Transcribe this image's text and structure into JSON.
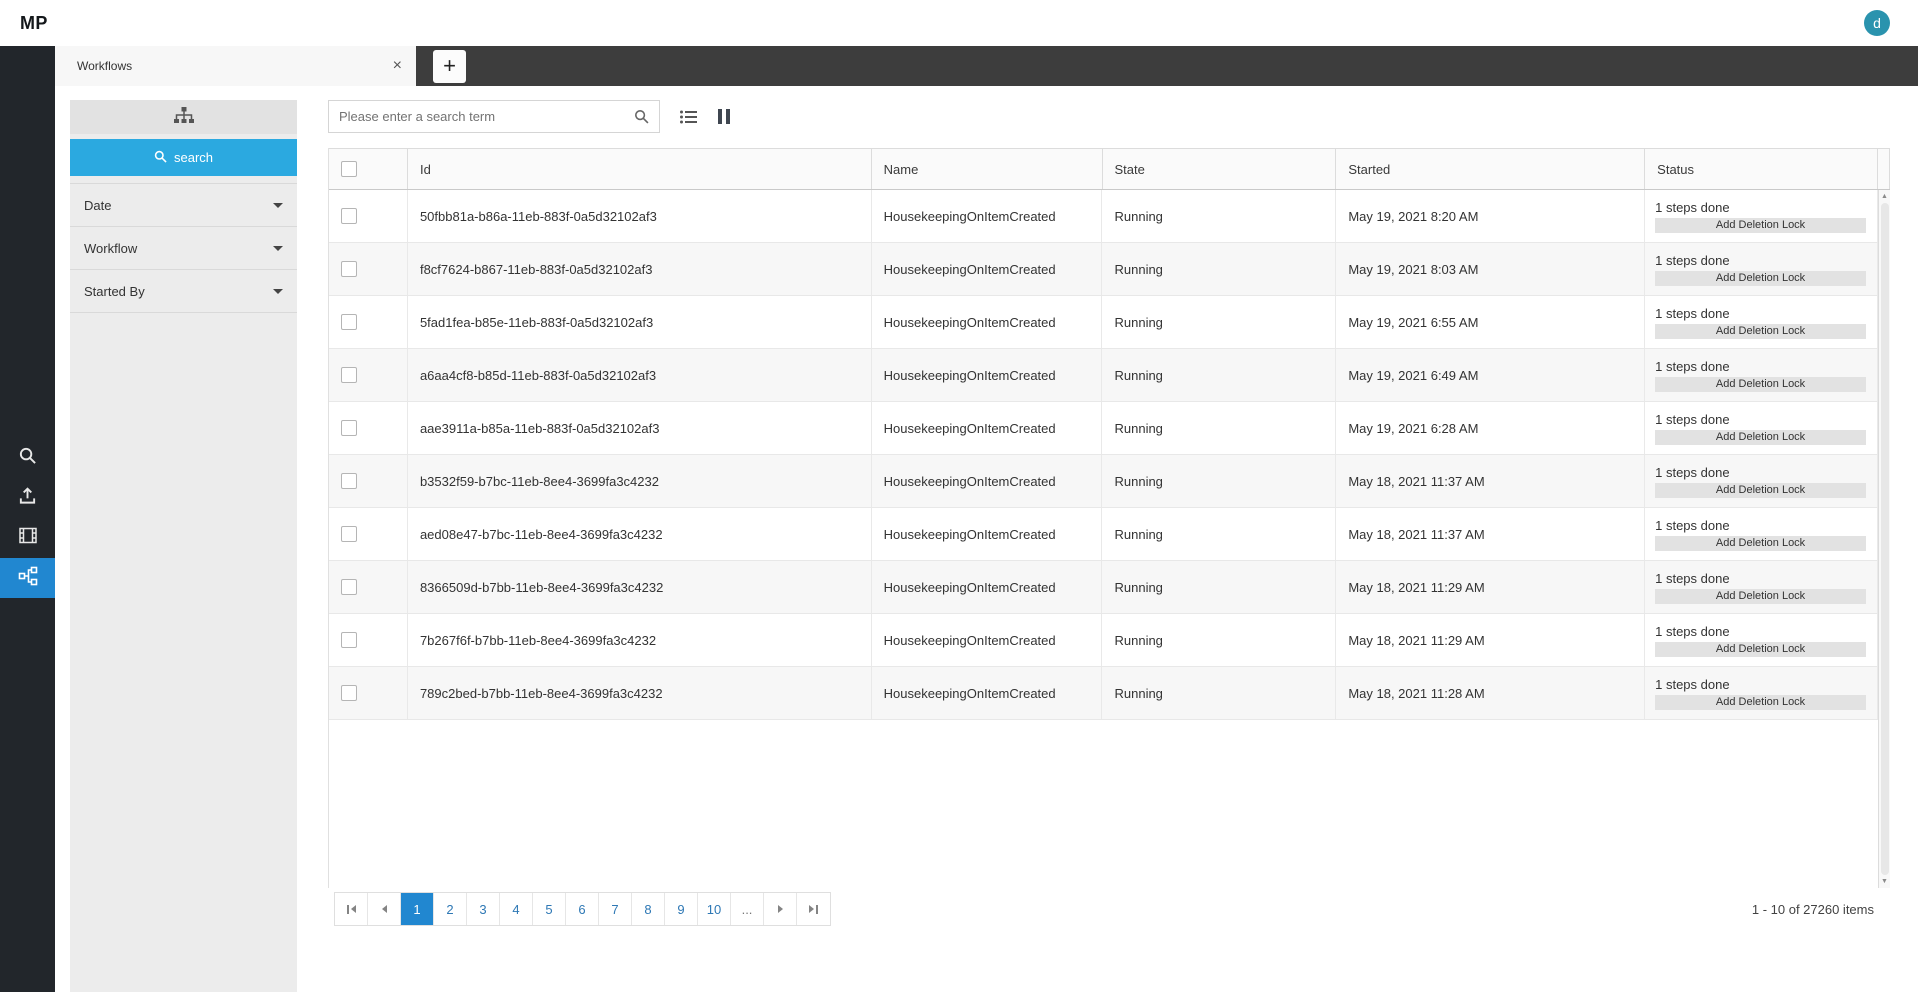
{
  "colors": {
    "sidebar_bg": "#22262b",
    "tabbar_bg": "#3d3d3d",
    "sidebar_active_blue": "#2187d0",
    "search_button_blue": "#2ba9e0",
    "pager_selected_blue": "#2187d0",
    "avatar_teal": "#2a93ae",
    "panel_gray": "#ececec"
  },
  "glyphs": {
    "close": "×",
    "plus": "+",
    "up": "▲",
    "down": "▼"
  },
  "app": {
    "logo": "MP",
    "avatar_initial": "d"
  },
  "tabs": {
    "items": [
      {
        "label": "Workflows"
      }
    ]
  },
  "sidebar": {
    "icons": [
      {
        "name": "search-icon"
      },
      {
        "name": "upload-icon"
      },
      {
        "name": "film-icon"
      },
      {
        "name": "workflow-icon",
        "active": true
      }
    ]
  },
  "filter_panel": {
    "toolbar_icon": "sitemap-icon",
    "search_button_label": "search",
    "sections": [
      {
        "label": "Date"
      },
      {
        "label": "Workflow"
      },
      {
        "label": "Started By"
      }
    ]
  },
  "toolbar": {
    "search_placeholder": "Please enter a search term"
  },
  "grid": {
    "columns": [
      "Id",
      "Name",
      "State",
      "Started",
      "Status"
    ],
    "rows": [
      {
        "id": "50fbb81a-b86a-11eb-883f-0a5d32102af3",
        "name": "HousekeepingOnItemCreated",
        "state": "Running",
        "started": "May 19, 2021 8:20 AM",
        "steps": "1 steps done",
        "action": "Add Deletion Lock"
      },
      {
        "id": "f8cf7624-b867-11eb-883f-0a5d32102af3",
        "name": "HousekeepingOnItemCreated",
        "state": "Running",
        "started": "May 19, 2021 8:03 AM",
        "steps": "1 steps done",
        "action": "Add Deletion Lock"
      },
      {
        "id": "5fad1fea-b85e-11eb-883f-0a5d32102af3",
        "name": "HousekeepingOnItemCreated",
        "state": "Running",
        "started": "May 19, 2021 6:55 AM",
        "steps": "1 steps done",
        "action": "Add Deletion Lock"
      },
      {
        "id": "a6aa4cf8-b85d-11eb-883f-0a5d32102af3",
        "name": "HousekeepingOnItemCreated",
        "state": "Running",
        "started": "May 19, 2021 6:49 AM",
        "steps": "1 steps done",
        "action": "Add Deletion Lock"
      },
      {
        "id": "aae3911a-b85a-11eb-883f-0a5d32102af3",
        "name": "HousekeepingOnItemCreated",
        "state": "Running",
        "started": "May 19, 2021 6:28 AM",
        "steps": "1 steps done",
        "action": "Add Deletion Lock"
      },
      {
        "id": "b3532f59-b7bc-11eb-8ee4-3699fa3c4232",
        "name": "HousekeepingOnItemCreated",
        "state": "Running",
        "started": "May 18, 2021 11:37 AM",
        "steps": "1 steps done",
        "action": "Add Deletion Lock"
      },
      {
        "id": "aed08e47-b7bc-11eb-8ee4-3699fa3c4232",
        "name": "HousekeepingOnItemCreated",
        "state": "Running",
        "started": "May 18, 2021 11:37 AM",
        "steps": "1 steps done",
        "action": "Add Deletion Lock"
      },
      {
        "id": "8366509d-b7bb-11eb-8ee4-3699fa3c4232",
        "name": "HousekeepingOnItemCreated",
        "state": "Running",
        "started": "May 18, 2021 11:29 AM",
        "steps": "1 steps done",
        "action": "Add Deletion Lock"
      },
      {
        "id": "7b267f6f-b7bb-11eb-8ee4-3699fa3c4232",
        "name": "HousekeepingOnItemCreated",
        "state": "Running",
        "started": "May 18, 2021 11:29 AM",
        "steps": "1 steps done",
        "action": "Add Deletion Lock"
      },
      {
        "id": "789c2bed-b7bb-11eb-8ee4-3699fa3c4232",
        "name": "HousekeepingOnItemCreated",
        "state": "Running",
        "started": "May 18, 2021 11:28 AM",
        "steps": "1 steps done",
        "action": "Add Deletion Lock"
      }
    ]
  },
  "pager": {
    "pages": [
      "1",
      "2",
      "3",
      "4",
      "5",
      "6",
      "7",
      "8",
      "9",
      "10"
    ],
    "ellipsis": "...",
    "current_page": "1",
    "info": "1 - 10 of 27260 items"
  }
}
